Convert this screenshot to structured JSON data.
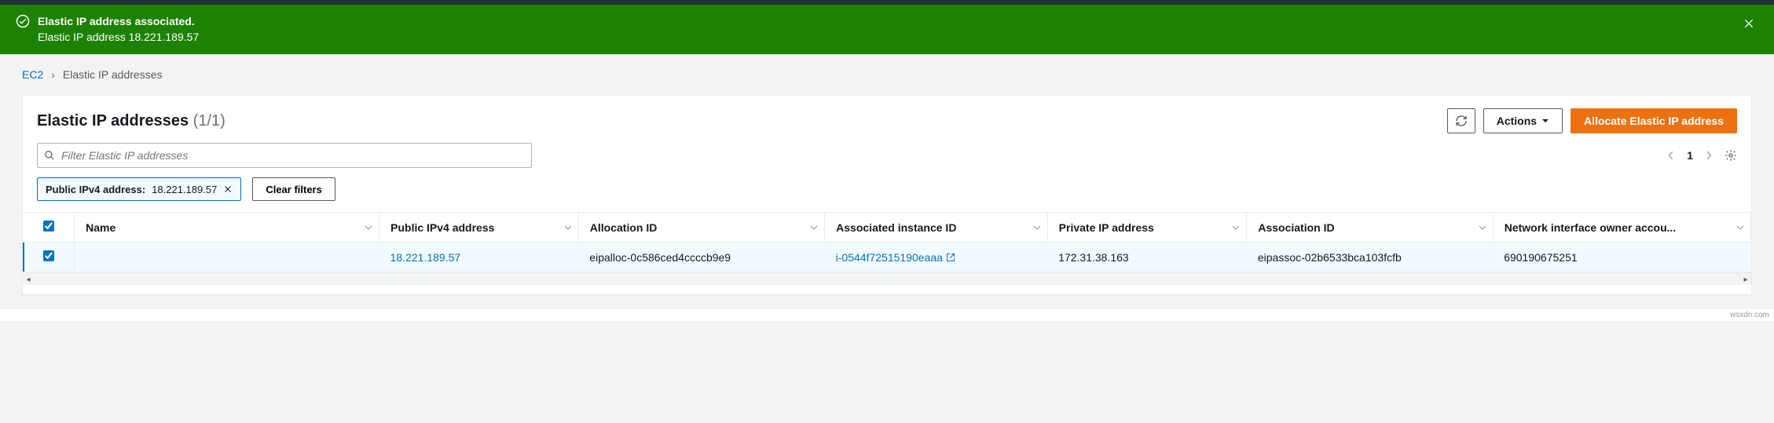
{
  "notification": {
    "title": "Elastic IP address associated.",
    "sub": "Elastic IP address 18.221.189.57"
  },
  "breadcrumbs": {
    "root": "EC2",
    "current": "Elastic IP addresses"
  },
  "header": {
    "title": "Elastic IP addresses",
    "count": "(1/1)",
    "actions_label": "Actions",
    "allocate_label": "Allocate Elastic IP address"
  },
  "search": {
    "placeholder": "Filter Elastic IP addresses"
  },
  "pagination": {
    "page": "1"
  },
  "filter": {
    "chip_key": "Public IPv4 address:",
    "chip_val": "18.221.189.57",
    "clear_label": "Clear filters"
  },
  "columns": {
    "c0": "Name",
    "c1": "Public IPv4 address",
    "c2": "Allocation ID",
    "c3": "Associated instance ID",
    "c4": "Private IP address",
    "c5": "Association ID",
    "c6": "Network interface owner accou..."
  },
  "rows": [
    {
      "name": "",
      "public_ip": "18.221.189.57",
      "allocation_id": "eipalloc-0c586ced4ccccb9e9",
      "instance_id": "i-0544f72515190eaaa",
      "private_ip": "172.31.38.163",
      "association_id": "eipassoc-02b6533bca103fcfb",
      "owner": "690190675251"
    }
  ],
  "credit": "wsxdn.com"
}
